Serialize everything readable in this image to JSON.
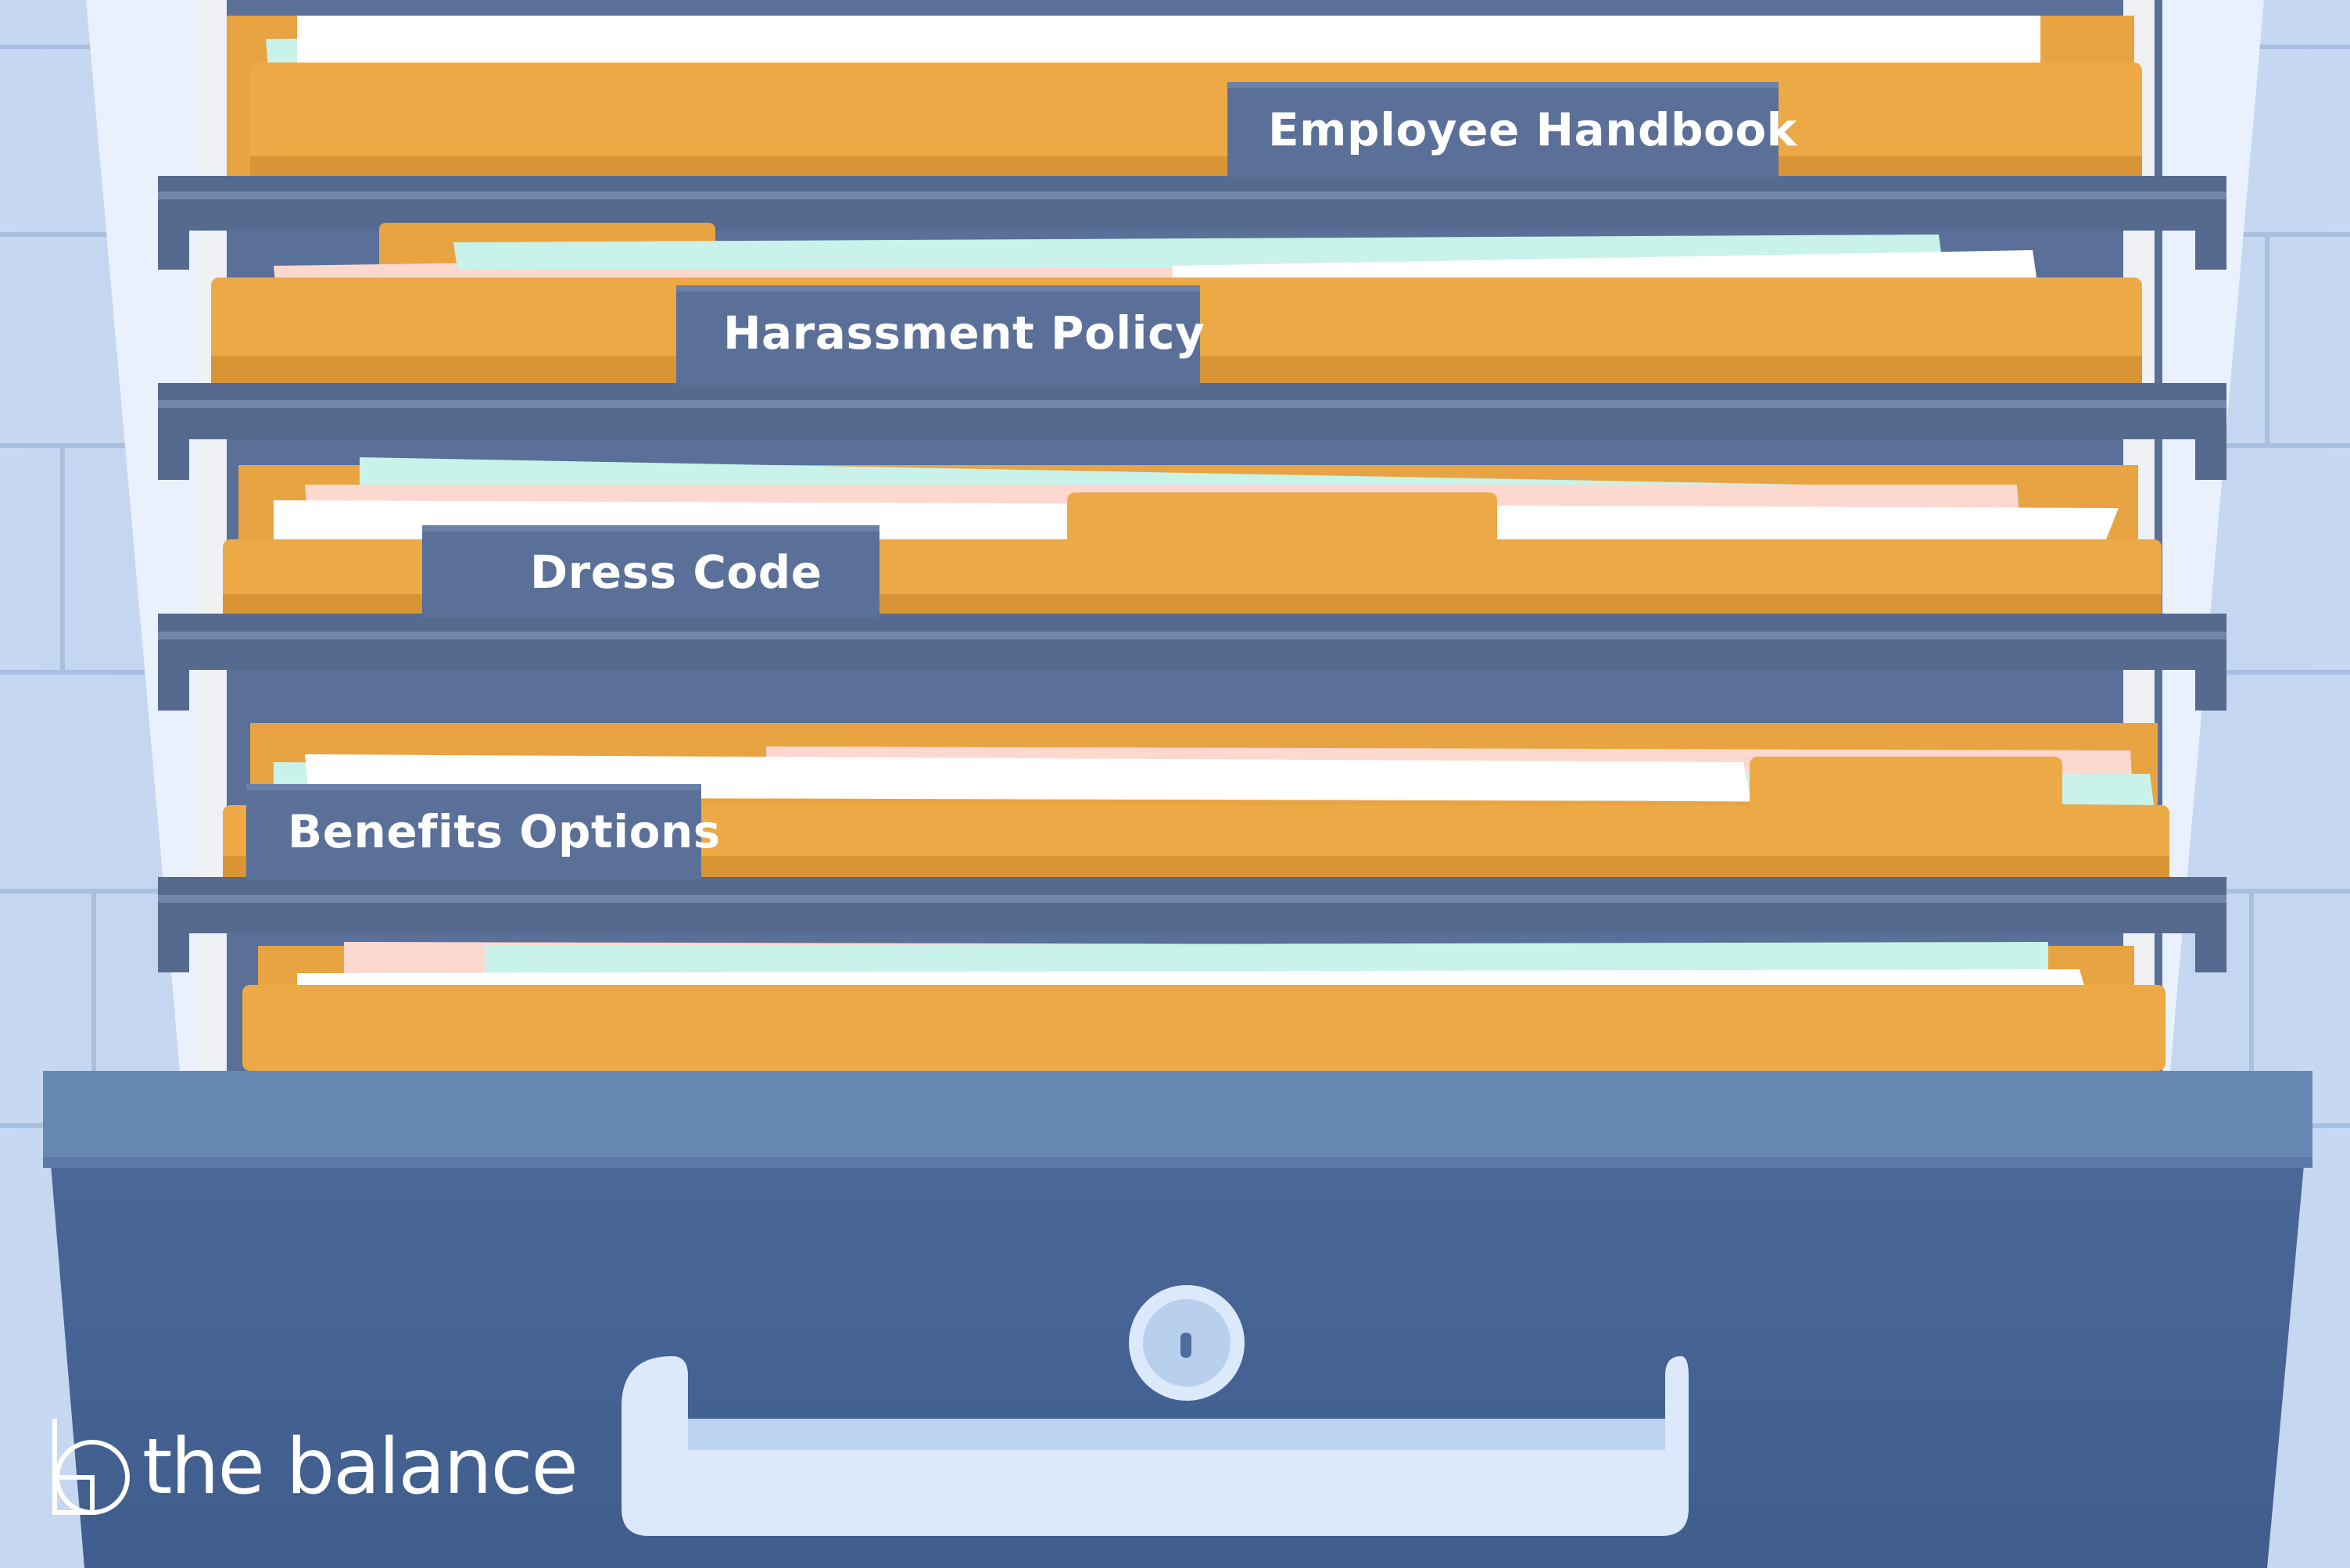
{
  "scene": {
    "description_free": true,
    "folder_tabs": [
      {
        "label": "Employee Handbook"
      },
      {
        "label": "Harassment Policy"
      },
      {
        "label": "Dress Code"
      },
      {
        "label": "Benefits Options"
      }
    ],
    "brand": {
      "name": "the balance",
      "icon": "balance-logo-icon"
    }
  },
  "colors": {
    "wall": "#b9cdeb",
    "cabinet": "#5a7099",
    "folder": "#eca946",
    "drawer_front": "#4e6c9c",
    "handle": "#dbe9fb",
    "paper_white": "#ffffff",
    "paper_pink": "#fdd8cf",
    "paper_mint": "#c9f3ec"
  }
}
